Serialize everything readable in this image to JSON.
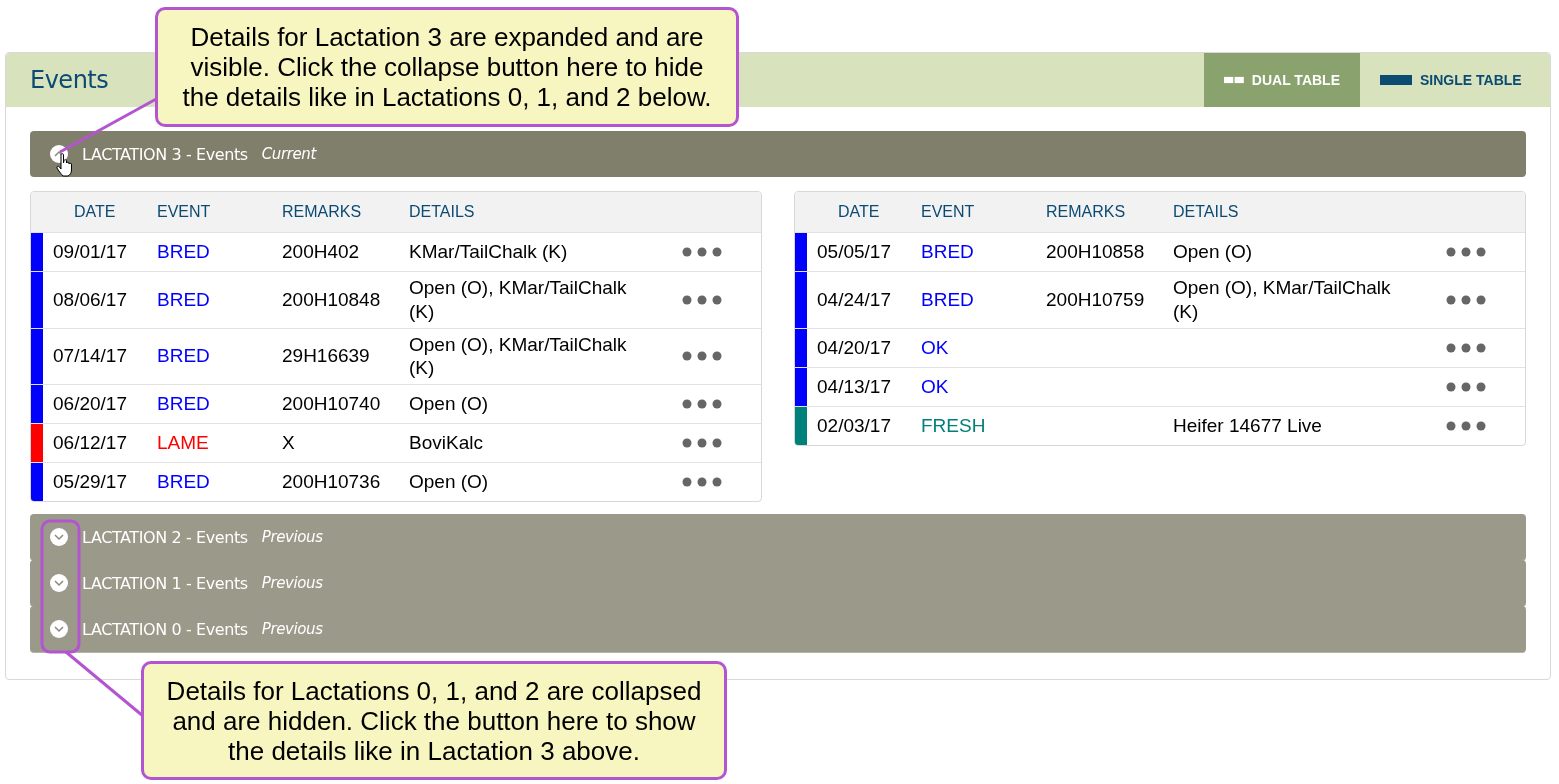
{
  "panel": {
    "title": "Events",
    "view_toggle": [
      {
        "label": "DUAL TABLE",
        "kind": "dual",
        "selected": true
      },
      {
        "label": "SINGLE TABLE",
        "kind": "single",
        "selected": false
      }
    ]
  },
  "lactations": [
    {
      "title": "LACTATION 3 - Events",
      "status": "Current",
      "expanded": true,
      "tables": [
        {
          "columns": [
            "DATE",
            "EVENT",
            "REMARKS",
            "DETAILS"
          ],
          "rows": [
            {
              "date": "09/01/17",
              "event": "BRED",
              "remarks": "200H402",
              "details": "KMar/TailChalk (K)",
              "color": "#0000ff"
            },
            {
              "date": "08/06/17",
              "event": "BRED",
              "remarks": "200H10848",
              "details": "Open (O), KMar/TailChalk (K)",
              "color": "#0000ff"
            },
            {
              "date": "07/14/17",
              "event": "BRED",
              "remarks": "29H16639",
              "details": "Open (O), KMar/TailChalk (K)",
              "color": "#0000ff"
            },
            {
              "date": "06/20/17",
              "event": "BRED",
              "remarks": "200H10740",
              "details": "Open (O)",
              "color": "#0000ff"
            },
            {
              "date": "06/12/17",
              "event": "LAME",
              "remarks": "X",
              "details": "BoviKalc",
              "color": "#ff0000"
            },
            {
              "date": "05/29/17",
              "event": "BRED",
              "remarks": "200H10736",
              "details": "Open (O)",
              "color": "#0000ff"
            }
          ]
        },
        {
          "columns": [
            "DATE",
            "EVENT",
            "REMARKS",
            "DETAILS"
          ],
          "rows": [
            {
              "date": "05/05/17",
              "event": "BRED",
              "remarks": "200H10858",
              "details": "Open (O)",
              "color": "#0000ff"
            },
            {
              "date": "04/24/17",
              "event": "BRED",
              "remarks": "200H10759",
              "details": "Open (O), KMar/TailChalk (K)",
              "color": "#0000ff"
            },
            {
              "date": "04/20/17",
              "event": "OK",
              "color": "#0000ff"
            },
            {
              "date": "04/13/17",
              "event": "OK",
              "color": "#0000ff"
            },
            {
              "date": "02/03/17",
              "event": "FRESH",
              "details": "Heifer 14677 Live",
              "color": "#00807a"
            }
          ]
        }
      ]
    },
    {
      "title": "LACTATION 2 - Events",
      "status": "Previous",
      "expanded": false
    },
    {
      "title": "LACTATION 1 - Events",
      "status": "Previous",
      "expanded": false
    },
    {
      "title": "LACTATION 0 - Events",
      "status": "Previous",
      "expanded": false
    }
  ],
  "callouts": [
    "Details for Lactation 3 are expanded and are visible. Click the collapse button here to hide the details like in Lactations 0, 1, and 2 below.",
    "Details for Lactations 0, 1, and 2 are collapsed and are hidden. Click the button here to show the details like in Lactation 3 above."
  ]
}
